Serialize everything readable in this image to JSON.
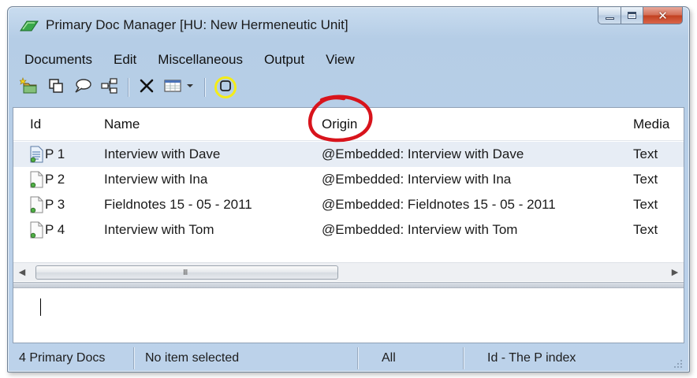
{
  "window": {
    "title": "Primary Doc Manager [HU: New Hermeneutic Unit]",
    "app_icon": "atlas-ti-icon",
    "controls": {
      "close_glyph": "✕"
    }
  },
  "menu": [
    "Documents",
    "Edit",
    "Miscellaneous",
    "Output",
    "View"
  ],
  "toolbar": {
    "buttons": [
      "new-document-icon",
      "copy-documents-icon",
      "comment-icon",
      "hierarchy-icon",
      "delete-icon",
      "columns-dropdown-icon",
      "highlight-icon"
    ]
  },
  "table": {
    "columns": [
      "Id",
      "Name",
      "Origin",
      "Media"
    ],
    "rows": [
      {
        "id": "P 1",
        "name": "Interview with Dave",
        "origin": "@Embedded: Interview with Dave",
        "media": "Text"
      },
      {
        "id": "P 2",
        "name": "Interview with Ina",
        "origin": "@Embedded: Interview with Ina",
        "media": "Text"
      },
      {
        "id": "P 3",
        "name": "Fieldnotes 15 - 05 - 2011",
        "origin": "@Embedded: Fieldnotes 15 - 05 - 2011",
        "media": "Text"
      },
      {
        "id": "P 4",
        "name": "Interview with Tom",
        "origin": "@Embedded: Interview with Tom",
        "media": "Text"
      }
    ],
    "scroll_grip": "III"
  },
  "status": {
    "count": "4 Primary Docs",
    "selection": "No item selected",
    "filter": "All",
    "sort": "Id - The P index"
  },
  "colors": {
    "annotation_circle": "#d8141c",
    "toolbar_highlight": "#f4ec18",
    "chrome": "#b5cde6"
  }
}
